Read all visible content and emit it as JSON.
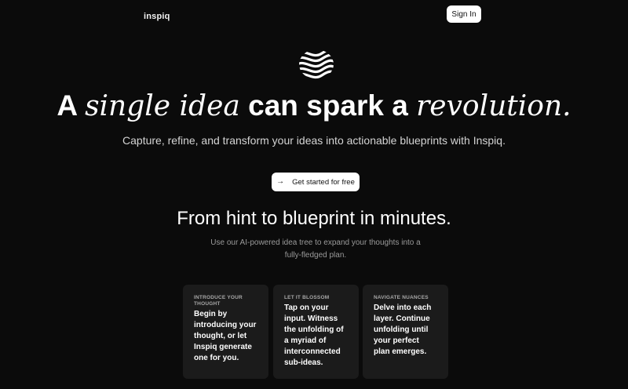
{
  "header": {
    "brand": "inspiq",
    "sign_in_label": "Sign In"
  },
  "logo": {
    "icon": "inspiq-wave-logo-icon"
  },
  "hero": {
    "title_part1": "A ",
    "title_part2": "single idea",
    "title_part3": " can spark a ",
    "title_part4": "revolution.",
    "subtitle": "Capture, refine, and transform your ideas into actionable blueprints with Inspiq.",
    "cta_label": "Get started for free",
    "cta_icon": "arrow-right-icon"
  },
  "section": {
    "title": "From hint to blueprint in minutes.",
    "subtitle": "Use our AI-powered idea tree to expand your thoughts into a fully-fledged plan."
  },
  "cards": [
    {
      "label": "INTRODUCE YOUR THOUGHT",
      "body": "Begin by introducing your thought, or let Inspiq generate one for you."
    },
    {
      "label": "LET IT BLOSSOM",
      "body": "Tap on your input. Witness the unfolding of a myriad of interconnected sub-ideas."
    },
    {
      "label": "NAVIGATE NUANCES",
      "body": "Delve into each layer. Continue unfolding until your perfect plan emerges."
    }
  ],
  "colors": {
    "background": "#0b0b0b",
    "card": "#1b1b1b",
    "button": "#ffffff"
  }
}
